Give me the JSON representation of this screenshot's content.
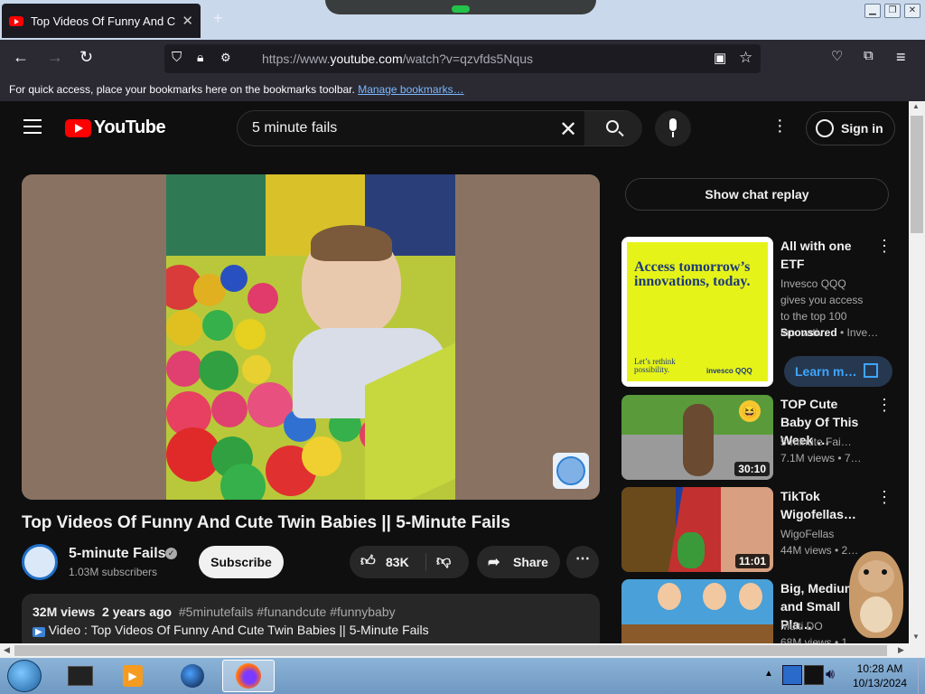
{
  "browser": {
    "tab_title": "Top Videos Of Funny And Cute Twin Babies || 5-Minute Fails",
    "tab_close": "✕",
    "new_tab": "+",
    "url_prefix": "https://www.",
    "url_host": "youtube.com",
    "url_path": "/watch?v=qzvfds5Nqus",
    "bookmarks_text": "For quick access, place your bookmarks here on the bookmarks toolbar.",
    "bookmarks_link": "Manage bookmarks…",
    "icons": [
      "back-icon",
      "forward-icon",
      "reload-icon",
      "shield-icon",
      "lock-icon",
      "permissions-icon",
      "reader-view-icon",
      "bookmark-star-icon",
      "pocket-icon",
      "extensions-icon",
      "menu-icon"
    ]
  },
  "youtube": {
    "logo_text": "YouTube",
    "search_value": "5 minute fails",
    "sign_in": "Sign in",
    "video": {
      "title": "Top Videos Of Funny And Cute Twin Babies || 5-Minute Fails",
      "channel": "5-minute Fails",
      "subscribers": "1.03M subscribers",
      "subscribe_label": "Subscribe",
      "likes": "83K",
      "share_label": "Share",
      "views": "32M views",
      "age": "2 years ago",
      "hashtags": "#5minutefails #funandcute #funnybaby",
      "desc_line": "Video : Top Videos Of Funny And Cute Twin Babies || 5-Minute Fails"
    },
    "chat_replay": "Show chat replay",
    "ad": {
      "headline": "Access tomorrow’s innovations, today.",
      "footer": "Let’s rethink possibility.",
      "brand": "invesco QQQ",
      "title": "All with one ETF",
      "description": "Invesco QQQ gives you access to the top 100 innovativ…",
      "sponsored": "Sponsored",
      "advertiser": "Inve…",
      "cta": "Learn m…"
    },
    "related": [
      {
        "title": "TOP Cute Baby Of This Week …",
        "channel": "5-minute Fai…",
        "stats": "7.1M views  •  7…",
        "duration": "30:10"
      },
      {
        "title": "TikTok Wigofellas…",
        "channel": "WigoFellas",
        "stats": "44M views  •  2…",
        "duration": "11:01"
      },
      {
        "title": "Big, Medium and Small Pla…",
        "channel": "Multi DO",
        "stats": "68M views  •  1…",
        "duration": ""
      }
    ]
  },
  "taskbar": {
    "time": "10:28 AM",
    "date": "10/13/2024"
  }
}
